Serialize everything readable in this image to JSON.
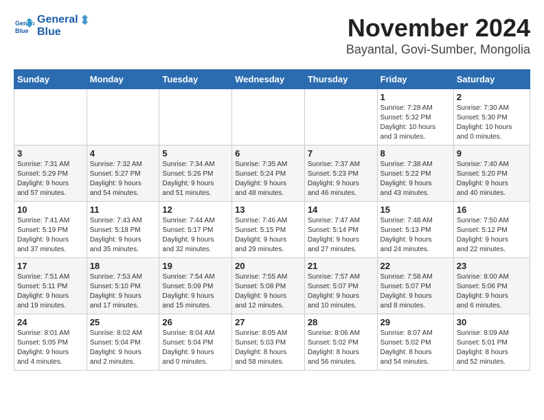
{
  "logo": {
    "line1": "General",
    "line2": "Blue"
  },
  "title": "November 2024",
  "subtitle": "Bayantal, Govi-Sumber, Mongolia",
  "headers": [
    "Sunday",
    "Monday",
    "Tuesday",
    "Wednesday",
    "Thursday",
    "Friday",
    "Saturday"
  ],
  "weeks": [
    [
      {
        "day": "",
        "info": ""
      },
      {
        "day": "",
        "info": ""
      },
      {
        "day": "",
        "info": ""
      },
      {
        "day": "",
        "info": ""
      },
      {
        "day": "",
        "info": ""
      },
      {
        "day": "1",
        "info": "Sunrise: 7:28 AM\nSunset: 5:32 PM\nDaylight: 10 hours\nand 3 minutes."
      },
      {
        "day": "2",
        "info": "Sunrise: 7:30 AM\nSunset: 5:30 PM\nDaylight: 10 hours\nand 0 minutes."
      }
    ],
    [
      {
        "day": "3",
        "info": "Sunrise: 7:31 AM\nSunset: 5:29 PM\nDaylight: 9 hours\nand 57 minutes."
      },
      {
        "day": "4",
        "info": "Sunrise: 7:32 AM\nSunset: 5:27 PM\nDaylight: 9 hours\nand 54 minutes."
      },
      {
        "day": "5",
        "info": "Sunrise: 7:34 AM\nSunset: 5:26 PM\nDaylight: 9 hours\nand 51 minutes."
      },
      {
        "day": "6",
        "info": "Sunrise: 7:35 AM\nSunset: 5:24 PM\nDaylight: 9 hours\nand 48 minutes."
      },
      {
        "day": "7",
        "info": "Sunrise: 7:37 AM\nSunset: 5:23 PM\nDaylight: 9 hours\nand 46 minutes."
      },
      {
        "day": "8",
        "info": "Sunrise: 7:38 AM\nSunset: 5:22 PM\nDaylight: 9 hours\nand 43 minutes."
      },
      {
        "day": "9",
        "info": "Sunrise: 7:40 AM\nSunset: 5:20 PM\nDaylight: 9 hours\nand 40 minutes."
      }
    ],
    [
      {
        "day": "10",
        "info": "Sunrise: 7:41 AM\nSunset: 5:19 PM\nDaylight: 9 hours\nand 37 minutes."
      },
      {
        "day": "11",
        "info": "Sunrise: 7:43 AM\nSunset: 5:18 PM\nDaylight: 9 hours\nand 35 minutes."
      },
      {
        "day": "12",
        "info": "Sunrise: 7:44 AM\nSunset: 5:17 PM\nDaylight: 9 hours\nand 32 minutes."
      },
      {
        "day": "13",
        "info": "Sunrise: 7:46 AM\nSunset: 5:15 PM\nDaylight: 9 hours\nand 29 minutes."
      },
      {
        "day": "14",
        "info": "Sunrise: 7:47 AM\nSunset: 5:14 PM\nDaylight: 9 hours\nand 27 minutes."
      },
      {
        "day": "15",
        "info": "Sunrise: 7:48 AM\nSunset: 5:13 PM\nDaylight: 9 hours\nand 24 minutes."
      },
      {
        "day": "16",
        "info": "Sunrise: 7:50 AM\nSunset: 5:12 PM\nDaylight: 9 hours\nand 22 minutes."
      }
    ],
    [
      {
        "day": "17",
        "info": "Sunrise: 7:51 AM\nSunset: 5:11 PM\nDaylight: 9 hours\nand 19 minutes."
      },
      {
        "day": "18",
        "info": "Sunrise: 7:53 AM\nSunset: 5:10 PM\nDaylight: 9 hours\nand 17 minutes."
      },
      {
        "day": "19",
        "info": "Sunrise: 7:54 AM\nSunset: 5:09 PM\nDaylight: 9 hours\nand 15 minutes."
      },
      {
        "day": "20",
        "info": "Sunrise: 7:55 AM\nSunset: 5:08 PM\nDaylight: 9 hours\nand 12 minutes."
      },
      {
        "day": "21",
        "info": "Sunrise: 7:57 AM\nSunset: 5:07 PM\nDaylight: 9 hours\nand 10 minutes."
      },
      {
        "day": "22",
        "info": "Sunrise: 7:58 AM\nSunset: 5:07 PM\nDaylight: 9 hours\nand 8 minutes."
      },
      {
        "day": "23",
        "info": "Sunrise: 8:00 AM\nSunset: 5:06 PM\nDaylight: 9 hours\nand 6 minutes."
      }
    ],
    [
      {
        "day": "24",
        "info": "Sunrise: 8:01 AM\nSunset: 5:05 PM\nDaylight: 9 hours\nand 4 minutes."
      },
      {
        "day": "25",
        "info": "Sunrise: 8:02 AM\nSunset: 5:04 PM\nDaylight: 9 hours\nand 2 minutes."
      },
      {
        "day": "26",
        "info": "Sunrise: 8:04 AM\nSunset: 5:04 PM\nDaylight: 9 hours\nand 0 minutes."
      },
      {
        "day": "27",
        "info": "Sunrise: 8:05 AM\nSunset: 5:03 PM\nDaylight: 8 hours\nand 58 minutes."
      },
      {
        "day": "28",
        "info": "Sunrise: 8:06 AM\nSunset: 5:02 PM\nDaylight: 8 hours\nand 56 minutes."
      },
      {
        "day": "29",
        "info": "Sunrise: 8:07 AM\nSunset: 5:02 PM\nDaylight: 8 hours\nand 54 minutes."
      },
      {
        "day": "30",
        "info": "Sunrise: 8:09 AM\nSunset: 5:01 PM\nDaylight: 8 hours\nand 52 minutes."
      }
    ]
  ]
}
